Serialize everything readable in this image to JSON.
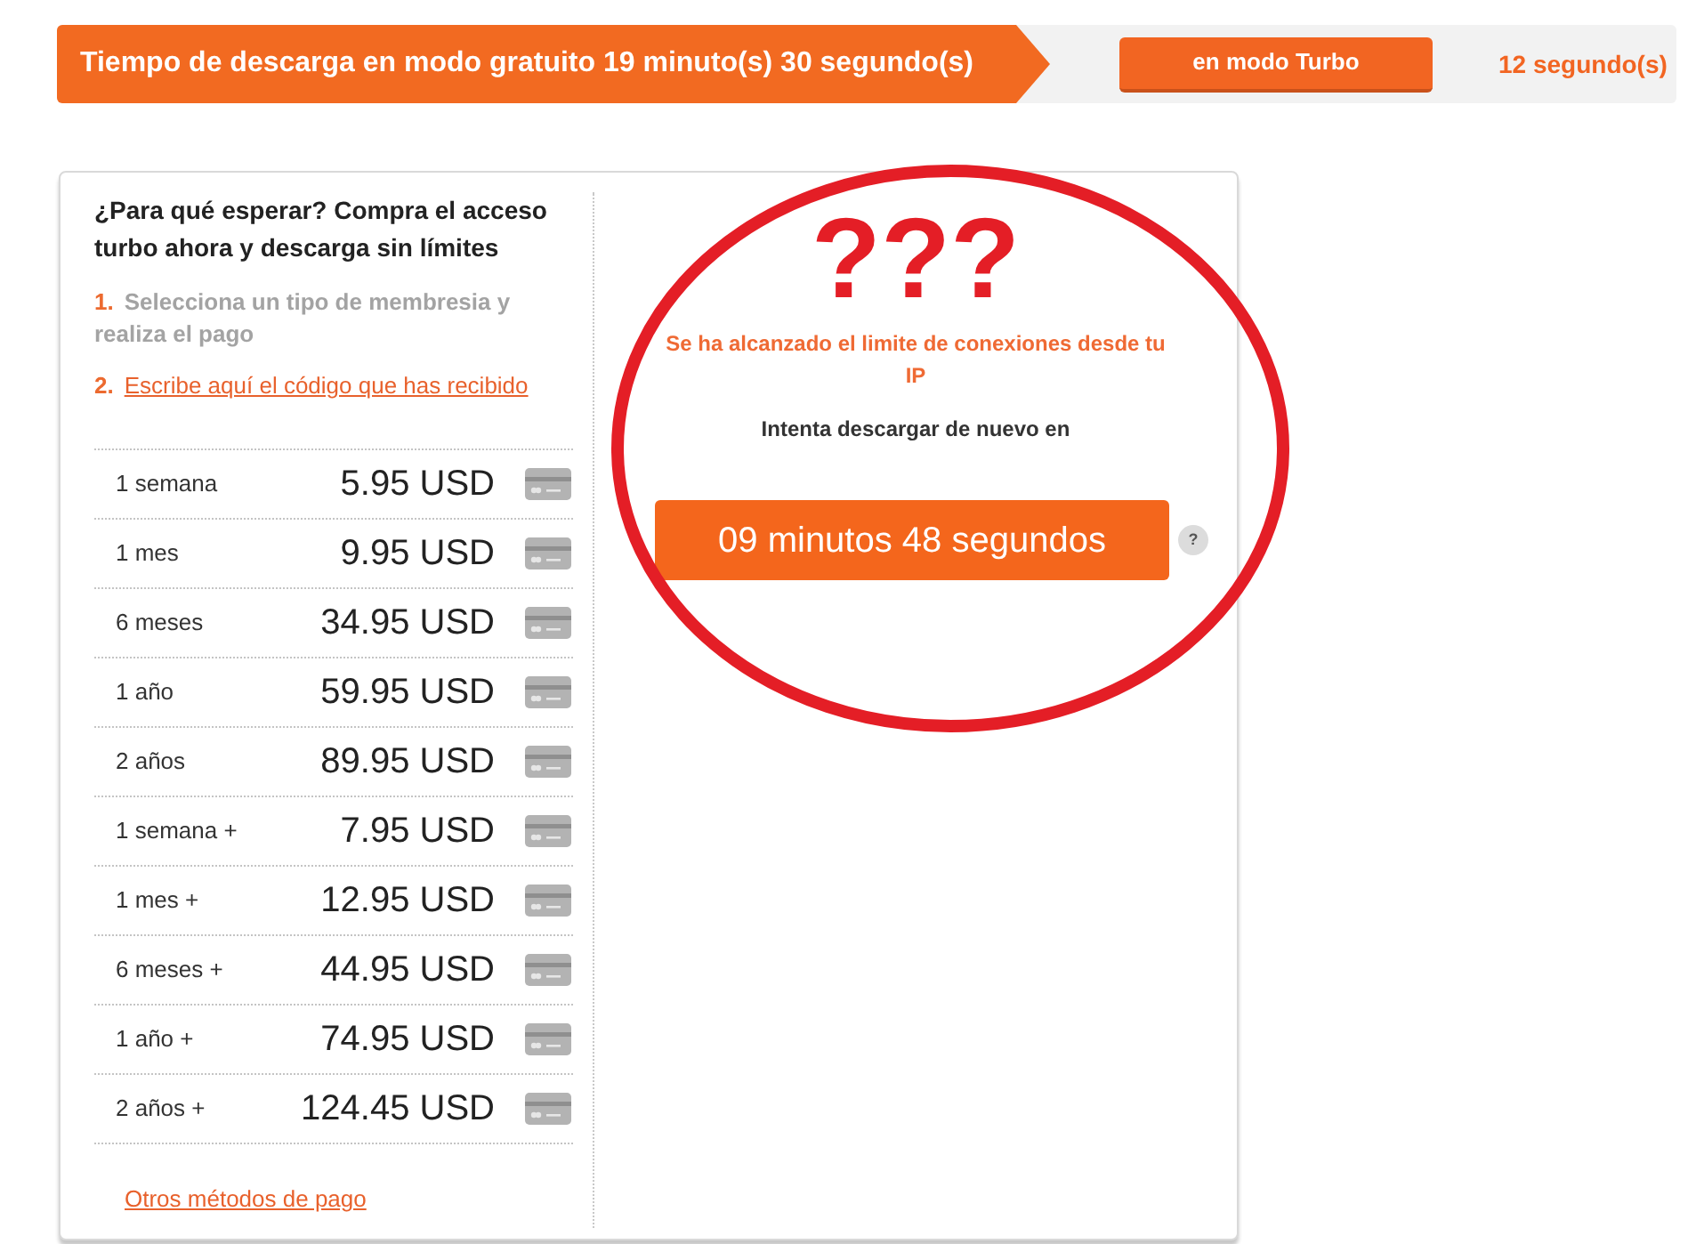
{
  "top_bar": {
    "free_wait": "Tiempo de descarga en modo gratuito 19 minuto(s) 30 segundo(s)",
    "turbo_button": "en modo Turbo",
    "turbo_wait": "12 segundo(s)"
  },
  "offer": {
    "heading": "¿Para qué esperar? Compra el acceso turbo ahora y descarga sin límites",
    "steps": [
      {
        "number": "1.",
        "text": "Selecciona un tipo de membresia y realiza el pago",
        "kind": "text"
      },
      {
        "number": "2.",
        "text": "Escribe aquí el código que has recibido",
        "kind": "link"
      }
    ],
    "plans": [
      {
        "duration": "1 semana",
        "price": "5.95 USD"
      },
      {
        "duration": "1 mes",
        "price": "9.95 USD"
      },
      {
        "duration": "6 meses",
        "price": "34.95 USD"
      },
      {
        "duration": "1 año",
        "price": "59.95 USD"
      },
      {
        "duration": "2 años",
        "price": "89.95 USD"
      },
      {
        "duration": "1 semana +",
        "price": "7.95 USD"
      },
      {
        "duration": "1 mes +",
        "price": "12.95 USD"
      },
      {
        "duration": "6 meses +",
        "price": "44.95 USD"
      },
      {
        "duration": "1 año +",
        "price": "74.95 USD"
      },
      {
        "duration": "2 años +",
        "price": "124.45 USD"
      }
    ],
    "other_payment_link": "Otros métodos de pago"
  },
  "limit_notice": {
    "annotation": "???",
    "message": "Se ha alcanzado el limite de conexiones desde tu IP",
    "retry_label": "Intenta descargar de nuevo en",
    "countdown": "09 minutos 48 segundos",
    "help": "?"
  }
}
